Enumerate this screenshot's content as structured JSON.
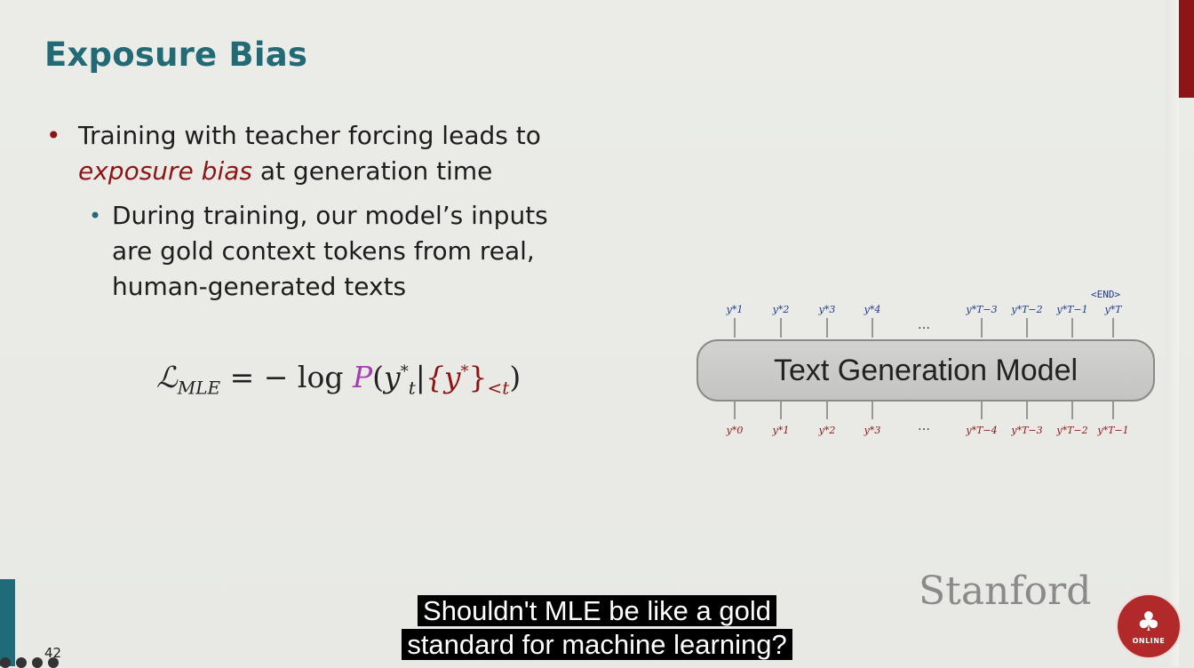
{
  "slide": {
    "title": "Exposure Bias",
    "bullet1_pre": "Training with teacher forcing leads to",
    "bullet1_em": "exposure bias",
    "bullet1_post": " at generation time",
    "bullet2": "During training, our model’s inputs are gold context tokens from real, human-generated texts",
    "formula": {
      "L": "ℒ",
      "L_sub": "MLE",
      "eq": " = − log ",
      "P": "P",
      "open": "(",
      "y": "y",
      "y_sup": "*",
      "y_sub": "t",
      "bar": "|",
      "set": "{y",
      "set_sup": "*",
      "set_close": "}",
      "set_sub": "<t",
      "close": ")"
    },
    "diagram": {
      "model_label": "Text Generation Model",
      "end_label": "<END>",
      "ellipsis": "…",
      "outputs": [
        "y*1",
        "y*2",
        "y*3",
        "y*4",
        "y*T−3",
        "y*T−2",
        "y*T−1",
        "y*T"
      ],
      "inputs": [
        "y*0",
        "y*1",
        "y*2",
        "y*3",
        "y*T−4",
        "y*T−3",
        "y*T−2",
        "y*T−1"
      ]
    },
    "brand": "Stanford",
    "logo_text": "ONLINE",
    "page_number": "42"
  },
  "caption": {
    "line1": "Shouldn't MLE be like a gold",
    "line2": "standard for machine learning?"
  },
  "colors": {
    "title": "#236a77",
    "accent_red": "#8c1515",
    "prob_purple": "#a43fb3",
    "token_blue": "#1e3a8a"
  }
}
